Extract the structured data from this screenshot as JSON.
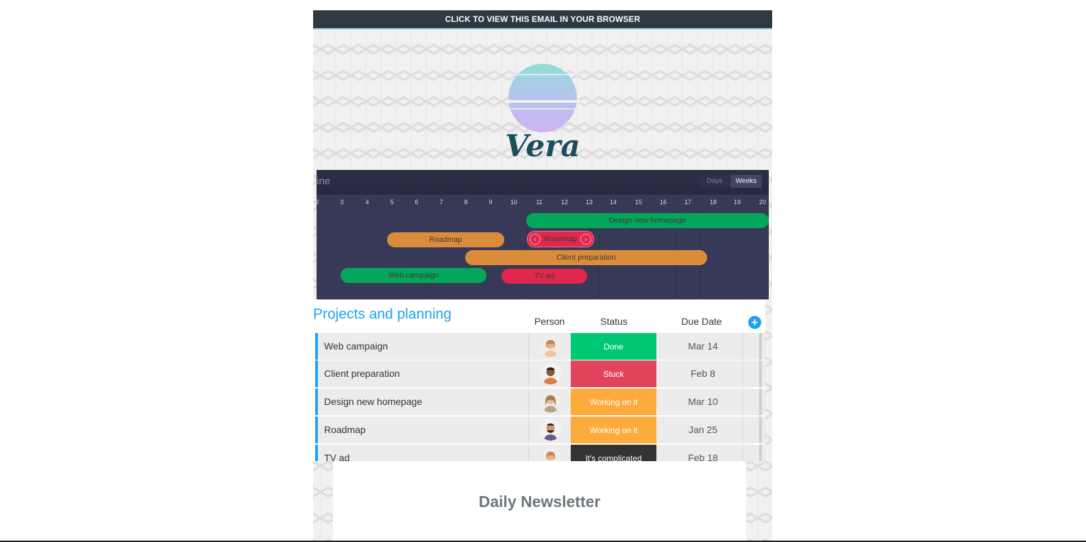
{
  "email": {
    "view_in_browser": "CLICK TO VIEW THIS EMAIL IN YOUR BROWSER",
    "brand": "Vera"
  },
  "timeline": {
    "title": "ine",
    "toggle_days": "Days",
    "toggle_weeks": "Weeks",
    "dates": [
      "2",
      "3",
      "4",
      "5",
      "6",
      "7",
      "8",
      "9",
      "10",
      "11",
      "12",
      "13",
      "14",
      "15",
      "16",
      "17",
      "18",
      "19",
      "20"
    ],
    "bars": [
      {
        "label": "Design new homepage",
        "color": "#03a65b"
      },
      {
        "label": "Roadmap",
        "color": "#db8c3a"
      },
      {
        "label": "Roadmap",
        "color": "#e0284f"
      },
      {
        "label": "Client preparation",
        "color": "#db8c3a"
      },
      {
        "label": "Web campaign",
        "color": "#03a65b"
      },
      {
        "label": "TV ad",
        "color": "#e0284f"
      }
    ]
  },
  "board": {
    "title": "Projects and planning",
    "columns": {
      "person": "Person",
      "status": "Status",
      "due": "Due Date"
    },
    "add_icon": "+",
    "rows": [
      {
        "name": "Web campaign",
        "status": "Done",
        "status_color": "#00c875",
        "due": "Mar 14"
      },
      {
        "name": "Client preparation",
        "status": "Stuck",
        "status_color": "#e2445c",
        "due": "Feb 8"
      },
      {
        "name": "Design new homepage",
        "status": "Working on it",
        "status_color": "#fdab3d",
        "due": "Mar 10"
      },
      {
        "name": "Roadmap",
        "status": "Working on it",
        "status_color": "#fdab3d",
        "due": "Jan 25"
      },
      {
        "name": "TV ad",
        "status": "It's complicated",
        "status_color": "#333333",
        "due": "Feb 18"
      }
    ]
  },
  "newsletter": {
    "title": "Daily Newsletter"
  },
  "colors": {
    "topbar": "#2f3943",
    "accent": "#1ba3ef",
    "timeline_bg": "#363a56"
  }
}
